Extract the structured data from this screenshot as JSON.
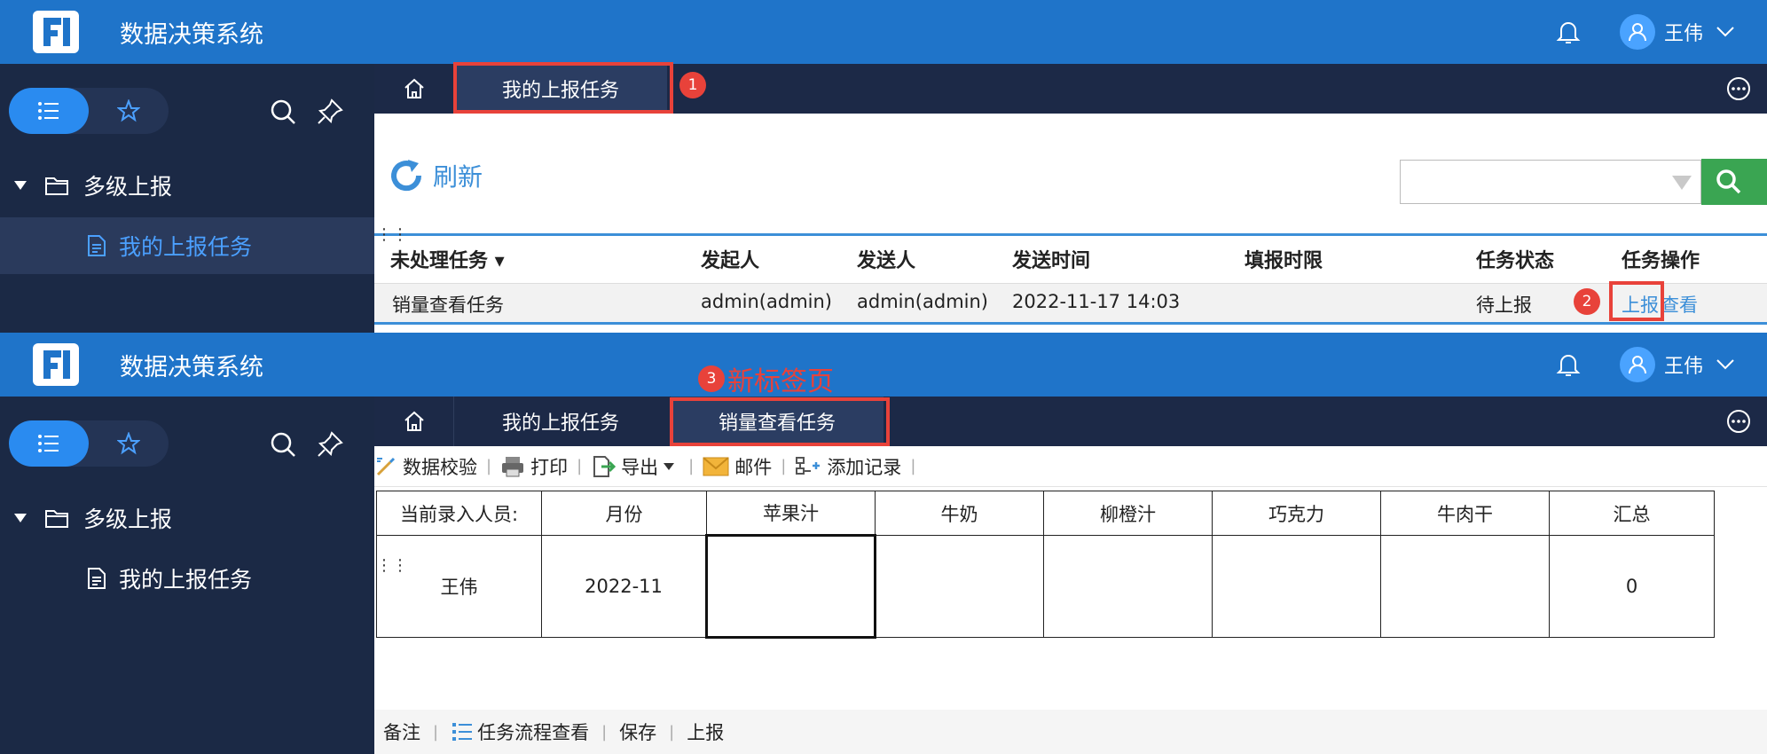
{
  "app": {
    "title": "数据决策系统",
    "user_name": "王伟"
  },
  "sidebar": {
    "folder_label": "多级上报",
    "leaf_label": "我的上报任务"
  },
  "screen1": {
    "tabs": [
      "我的上报任务"
    ],
    "badge1": "1",
    "refresh_label": "刷新",
    "table": {
      "headers": [
        "未处理任务",
        "发起人",
        "发送人",
        "发送时间",
        "填报时限",
        "任务状态",
        "任务操作"
      ],
      "rows": [
        {
          "task": "销量查看任务",
          "initiator": "admin(admin)",
          "sender": "admin(admin)",
          "send_time": "2022-11-17 14:03",
          "deadline": "",
          "status": "待上报",
          "op_report": "上报",
          "op_view": "查看"
        }
      ]
    },
    "badge2": "2"
  },
  "screen2": {
    "tabs": [
      "我的上报任务",
      "销量查看任务"
    ],
    "badge3": "3",
    "new_tab_note": "新标签页",
    "toolbar": [
      "数据校验",
      "打印",
      "导出",
      "邮件",
      "添加记录"
    ],
    "form": {
      "headers": [
        "当前录入人员:",
        "月份",
        "苹果汁",
        "牛奶",
        "柳橙汁",
        "巧克力",
        "牛肉干",
        "汇总"
      ],
      "row": [
        "王伟",
        "2022-11",
        "",
        "",
        "",
        "",
        "",
        "0"
      ]
    },
    "bottom_bar": [
      "备注",
      "任务流程查看",
      "保存",
      "上报"
    ]
  },
  "colors": {
    "topbar": "#1f74c9",
    "sidebar": "#1b2945",
    "tabbar": "#1c2947",
    "accent_blue": "#3c8fd8",
    "highlight_red": "#e8423a",
    "search_green": "#3aa552"
  }
}
